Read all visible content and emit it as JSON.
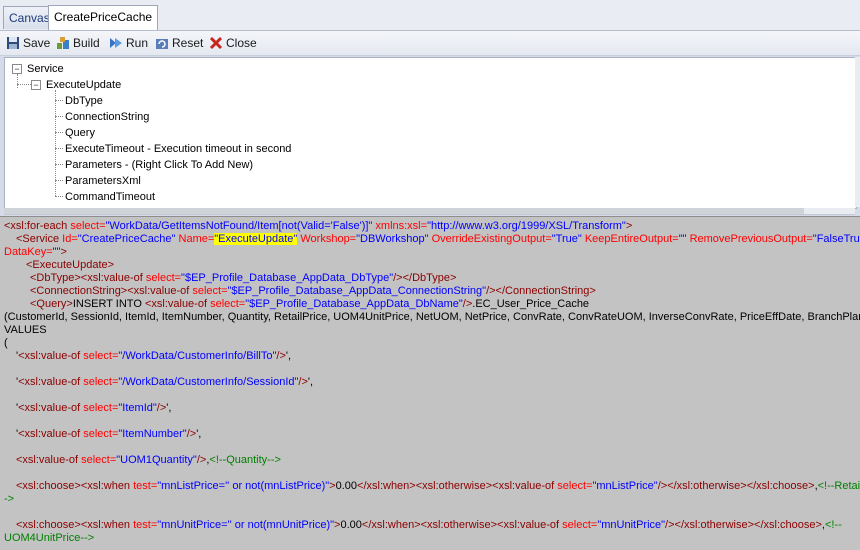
{
  "tabs": [
    "Canvas",
    "CreatePriceCache"
  ],
  "toolbar": {
    "save": "Save",
    "build": "Build",
    "run": "Run",
    "reset": "Reset",
    "close": "Close"
  },
  "tree": {
    "root": "Service",
    "child": "ExecuteUpdate",
    "leaves": [
      "DbType",
      "ConnectionString",
      "Query",
      "ExecuteTimeout - Execution timeout in second",
      "Parameters - (Right Click To Add New)",
      "ParametersXml",
      "CommandTimeout"
    ]
  },
  "code": {
    "l1": [
      "<xsl:for-each",
      " select=",
      "\"WorkData/GetItemsNotFound/Item[not(Valid='False')]\"",
      " xmlns:xsl=",
      "\"http://www.w3.org/1999/XSL/Transform\"",
      ">"
    ],
    "l2": [
      "<Service",
      " Id=",
      "\"CreatePriceCache\"",
      " Name=",
      "\"ExecuteUpdate\"",
      " Workshop=",
      "\"DBWorkshop\"",
      " OverrideExistingOutput=",
      "\"True\"",
      " KeepEntireOutput=",
      "\"\"",
      " RemovePreviousOutput=",
      "\"FalseTrue\""
    ],
    "l3": [
      "DataKey=",
      "\"\"",
      ">"
    ],
    "l4": "<ExecuteUpdate>",
    "l5": [
      "<DbType>",
      "<xsl:value-of",
      " select=",
      "\"$EP_Profile_Database_AppData_DbType\"",
      "/>",
      "</DbType>"
    ],
    "l6": [
      "<ConnectionString>",
      "<xsl:value-of",
      " select=",
      "\"$EP_Profile_Database_AppData_ConnectionString\"",
      "/>",
      "</ConnectionString>"
    ],
    "l7": [
      "<Query>",
      "INSERT INTO ",
      "<xsl:value-of",
      " select=",
      "\"$EP_Profile_Database_AppData_DbName\"",
      "/>",
      ".EC_User_Price_Cache"
    ],
    "l8": "(CustomerId, SessionId, ItemId, ItemNumber, Quantity, RetailPrice, UOM4UnitPrice, NetUOM, NetPrice, ConvRate, ConvRateUOM, InverseConvRate, PriceEffDate, BranchPlant)",
    "l9": "VALUES",
    "l10": "(",
    "l11": [
      "'",
      "<xsl:value-of",
      " select=",
      "\"/WorkData/CustomerInfo/BillTo\"",
      "/>",
      "',"
    ],
    "l12": [
      "'",
      "<xsl:value-of",
      " select=",
      "\"/WorkData/CustomerInfo/SessionId\"",
      "/>",
      "',"
    ],
    "l13": [
      "'",
      "<xsl:value-of",
      " select=",
      "\"ItemId\"",
      "/>",
      "',"
    ],
    "l14": [
      "'",
      "<xsl:value-of",
      " select=",
      "\"ItemNumber\"",
      "/>",
      "',"
    ],
    "l15": [
      "<xsl:value-of",
      " select=",
      "\"UOM1Quantity\"",
      "/>",
      ",",
      "<!--Quantity-->"
    ],
    "l16": [
      "<xsl:choose>",
      "<xsl:when",
      " test=",
      "\"mnListPrice='' or not(mnListPrice)\"",
      ">",
      "0.00",
      "</xsl:when>",
      "<xsl:otherwise>",
      "<xsl:value-of",
      " select=",
      "\"mnListPrice\"",
      "/>",
      "</xsl:otherwise>",
      "</xsl:choose>",
      ",",
      "<!--RetailPrice-"
    ],
    "l17": "->",
    "l18": [
      "<xsl:choose>",
      "<xsl:when",
      " test=",
      "\"mnUnitPrice='' or not(mnUnitPrice)\"",
      ">",
      "0.00",
      "</xsl:when>",
      "<xsl:otherwise>",
      "<xsl:value-of",
      " select=",
      "\"mnUnitPrice\"",
      "/>",
      "</xsl:otherwise>",
      "</xsl:choose>",
      ",",
      "<!--"
    ],
    "l19": "UOM4UnitPrice-->"
  },
  "colors": {
    "tag": "#8b0000",
    "attr": "#ff0000",
    "value": "#0000ff",
    "comment": "#008000",
    "highlight": "#ffff00"
  }
}
